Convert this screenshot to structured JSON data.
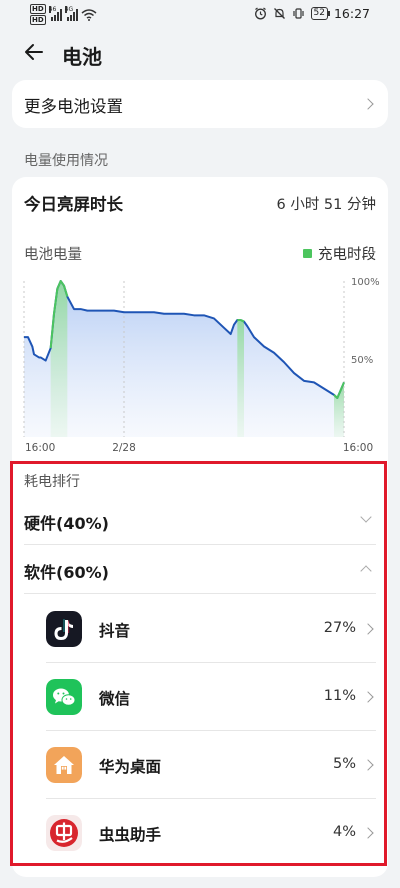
{
  "status_bar": {
    "left_badges": [
      "HD",
      "HD"
    ],
    "net_labels": [
      "46",
      "4G"
    ],
    "battery": "52",
    "time": "16:27"
  },
  "header": {
    "title": "电池"
  },
  "more_settings": {
    "label": "更多电池设置"
  },
  "section": {
    "label": "电量使用情况"
  },
  "screen_time": {
    "label": "今日亮屏时长",
    "value": "6 小时 51 分钟"
  },
  "chart_data": {
    "type": "area",
    "title": "电池电量",
    "legend": [
      {
        "name": "充电时段",
        "color": "#4cc55e"
      }
    ],
    "line_color": "#1f55b5",
    "charge_color": "#4cc55e",
    "x_ticks": [
      "16:00",
      "2/28",
      "16:00"
    ],
    "y_ticks": [
      "100%",
      "50%"
    ],
    "ylim": [
      0,
      100
    ],
    "x": [
      0,
      1.2,
      2.5,
      3,
      4.5,
      5,
      6.5,
      8,
      9,
      10,
      11,
      12,
      13,
      15,
      17,
      19,
      21,
      24,
      27,
      30,
      33,
      35,
      37,
      39,
      42,
      45,
      48,
      51,
      54,
      57,
      60,
      62,
      63,
      64,
      65,
      66,
      67,
      69,
      72,
      75,
      78,
      81,
      84,
      87,
      90,
      93,
      94,
      96
    ],
    "values": [
      64,
      64,
      58,
      53,
      51,
      51,
      49,
      57,
      79,
      95,
      100,
      97,
      90,
      82,
      82,
      81,
      81,
      81,
      81,
      80,
      80,
      80,
      80,
      80,
      79,
      79,
      79,
      78,
      78,
      76,
      70,
      66,
      72,
      75,
      75,
      74,
      71,
      64,
      58,
      54,
      48,
      41,
      36,
      35,
      31,
      27,
      25,
      35
    ],
    "charge_segments": [
      [
        7,
        13
      ],
      [
        64,
        66
      ],
      [
        93,
        96
      ]
    ],
    "grid": false
  },
  "ranking": {
    "label": "耗电排行",
    "groups": [
      {
        "label": "硬件(40%)",
        "state": "collapsed"
      },
      {
        "label": "软件(60%)",
        "state": "expanded"
      }
    ],
    "apps": [
      {
        "name": "抖音",
        "pct": "27%",
        "icon": "douyin-icon"
      },
      {
        "name": "微信",
        "pct": "11%",
        "icon": "wechat-icon"
      },
      {
        "name": "华为桌面",
        "pct": "5%",
        "icon": "huawei-home-icon"
      },
      {
        "name": "虫虫助手",
        "pct": "4%",
        "icon": "chongchong-icon"
      }
    ]
  },
  "highlight": {
    "color": "#e0192b"
  }
}
